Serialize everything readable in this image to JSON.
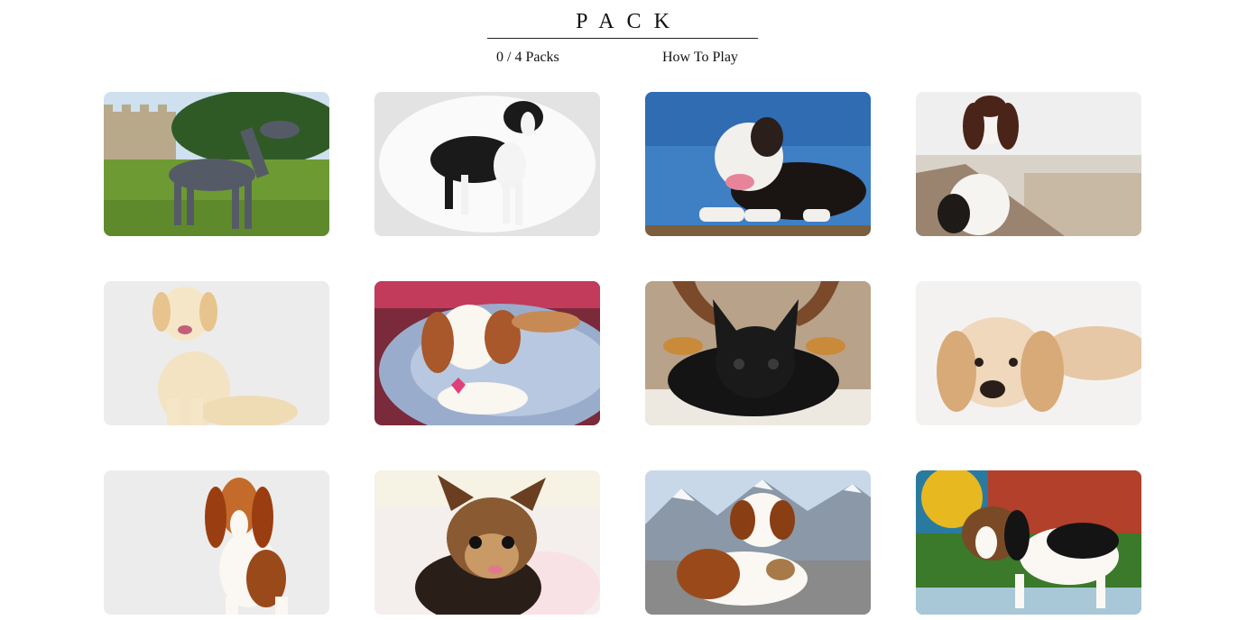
{
  "header": {
    "title": "PACK",
    "packs_progress": "0 / 4 Packs",
    "how_to_play": "How To Play"
  },
  "packs": {
    "completed": 0,
    "total": 4
  },
  "cards": [
    {
      "id": "great-dane",
      "depicts": "Great Dane on grass by castle"
    },
    {
      "id": "border-collie",
      "depicts": "Border collie on white"
    },
    {
      "id": "pit-bull",
      "depicts": "Pit bull on dock under blue sky"
    },
    {
      "id": "springer-spaniel",
      "depicts": "Springer spaniel puppy on pier"
    },
    {
      "id": "golden-retriever",
      "depicts": "Golden retriever puppy sitting"
    },
    {
      "id": "cavalier",
      "depicts": "Cavalier King Charles puppy in bed"
    },
    {
      "id": "french-bulldog",
      "depicts": "French bulldog with reindeer antlers"
    },
    {
      "id": "cocker-spaniel",
      "depicts": "Cocker spaniel puppy lying down"
    },
    {
      "id": "basset-hound",
      "depicts": "Basset hound standing"
    },
    {
      "id": "yorkie",
      "depicts": "Yorkshire terrier puppy"
    },
    {
      "id": "saint-bernard",
      "depicts": "Saint Bernard in mountains"
    },
    {
      "id": "beagle",
      "depicts": "Beagle puppy on colorful background"
    }
  ],
  "colors": {
    "background": "#ffffff",
    "text": "#111111",
    "card_light_bg": "#ececec"
  }
}
